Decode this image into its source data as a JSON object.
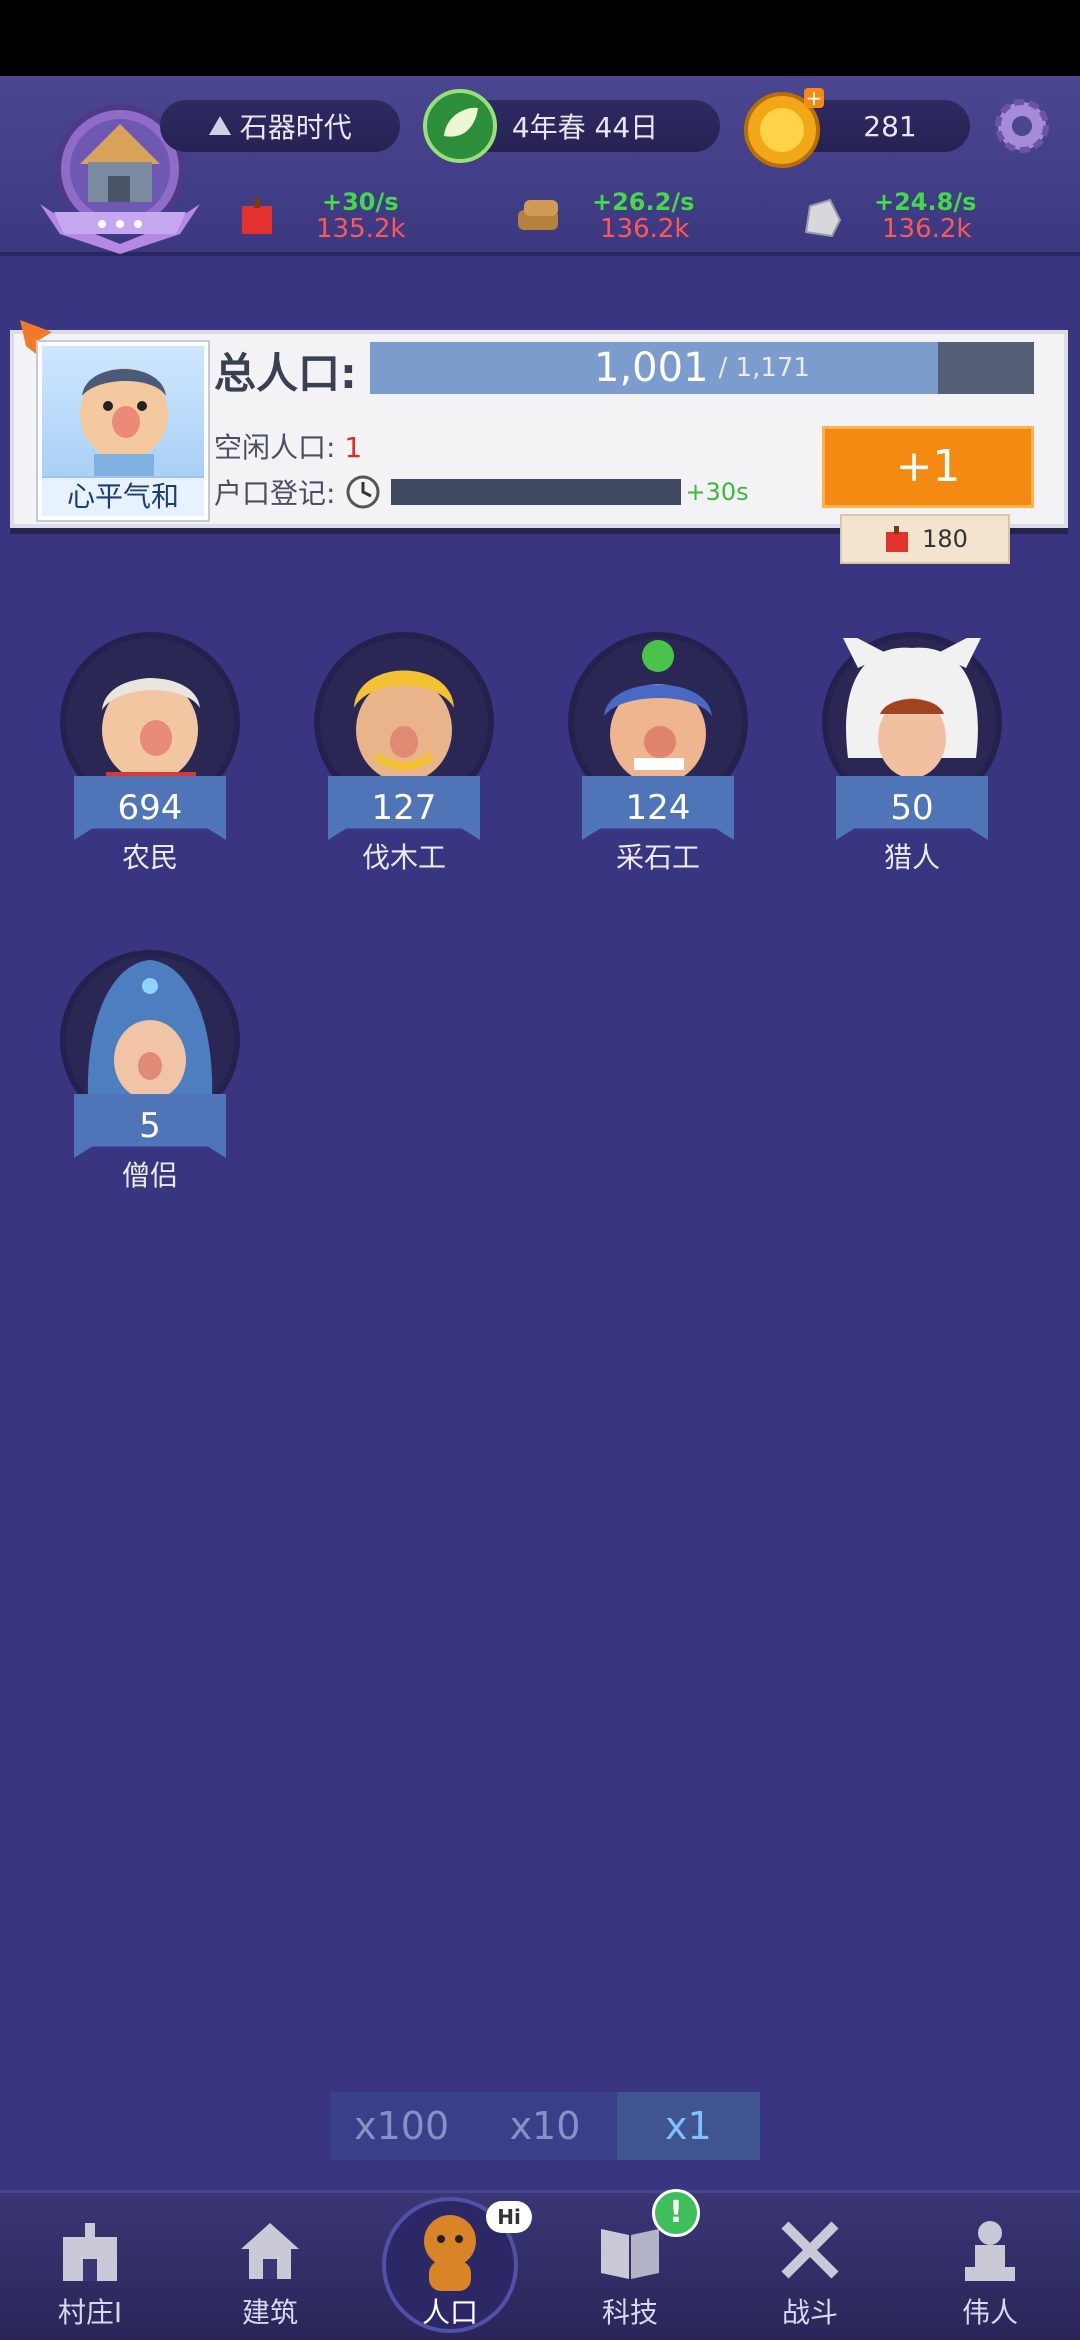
{
  "header": {
    "era": "石器时代",
    "date": "4年春 44日",
    "coins": "281",
    "resources": [
      {
        "icon": "meat-icon",
        "rate": "+30/s",
        "amount": "135.2k"
      },
      {
        "icon": "wood-icon",
        "rate": "+26.2/s",
        "amount": "136.2k"
      },
      {
        "icon": "stone-icon",
        "rate": "+24.8/s",
        "amount": "136.2k"
      }
    ]
  },
  "population": {
    "mood": "心平气和",
    "total_label": "总人口:",
    "current": "1,001",
    "capacity": "/ 1,171",
    "fill_fraction": 0.855,
    "idle_label": "空闲人口:",
    "idle_value": "1",
    "register_label": "户口登记:",
    "register_bonus": "+30s",
    "add_button": "+1",
    "cost": "180"
  },
  "roles": [
    {
      "name": "农民",
      "count": "694"
    },
    {
      "name": "伐木工",
      "count": "127"
    },
    {
      "name": "采石工",
      "count": "124"
    },
    {
      "name": "猎人",
      "count": "50"
    },
    {
      "name": "僧侣",
      "count": "5"
    }
  ],
  "speed": {
    "options": [
      "x100",
      "x10",
      "x1"
    ],
    "selected": "x1"
  },
  "nav": [
    {
      "label": "村庄I",
      "icon": "village-icon"
    },
    {
      "label": "建筑",
      "icon": "house-icon"
    },
    {
      "label": "人口",
      "icon": "population-icon",
      "badge": "Hi"
    },
    {
      "label": "科技",
      "icon": "book-icon",
      "badge": "!"
    },
    {
      "label": "战斗",
      "icon": "swords-icon"
    },
    {
      "label": "伟人",
      "icon": "statue-icon"
    }
  ],
  "colors": {
    "background": "#3a3580",
    "accent_orange": "#f58a12",
    "rate_green": "#45d84a",
    "amount_red": "#ff5656"
  }
}
